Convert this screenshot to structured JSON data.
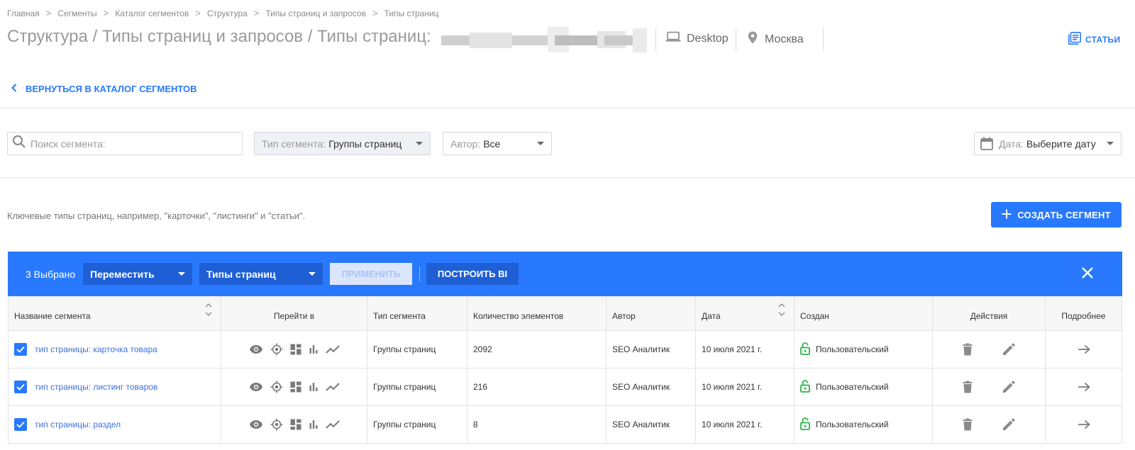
{
  "breadcrumb": [
    "Главная",
    "Сегменты",
    "Каталог сегментов",
    "Структура",
    "Типы страниц и запросов",
    "Типы страниц"
  ],
  "title": "Структура / Типы страниц и запросов / Типы страниц:",
  "device": "Desktop",
  "city": "Москва",
  "articles_link": "СТАТЬИ",
  "back_link": "ВЕРНУТЬСЯ В КАТАЛОГ СЕГМЕНТОВ",
  "filters": {
    "search_placeholder": "Поиск сегмента:",
    "type_label": "Тип сегмента:",
    "type_value": "Группы страниц",
    "author_label": "Автор:",
    "author_value": "Все",
    "date_label": "Дата:",
    "date_value": "Выберите дату"
  },
  "description": "Ключевые типы страниц, например, \"карточки\", \"листинги\" и \"статьи\".",
  "create_button": "СОЗДАТЬ СЕГМЕНТ",
  "bulk_bar": {
    "selected_count": "3 Выбрано",
    "action_select": "Переместить",
    "target_select": "Типы страниц",
    "apply_button": "ПРИМЕНИТЬ",
    "build_bi_button": "ПОСТРОИТЬ BI"
  },
  "table": {
    "headers": {
      "name": "Название сегмента",
      "goto": "Перейти в",
      "type": "Тип сегмента",
      "count": "Количество элементов",
      "author": "Автор",
      "date": "Дата",
      "created": "Создан",
      "actions": "Действия",
      "details": "Подробнее"
    },
    "rows": [
      {
        "name": "тип страницы: карточка товара",
        "type": "Группы страниц",
        "count": "2092",
        "author": "SEO Аналитик",
        "date": "10 июля 2021 г.",
        "created": "Пользовательский"
      },
      {
        "name": "тип страницы: листинг товаров",
        "type": "Группы страниц",
        "count": "216",
        "author": "SEO Аналитик",
        "date": "10 июля 2021 г.",
        "created": "Пользовательский"
      },
      {
        "name": "тип страницы: раздел",
        "type": "Группы страниц",
        "count": "8",
        "author": "SEO Аналитик",
        "date": "10 июля 2021 г.",
        "created": "Пользовательский"
      }
    ]
  },
  "colors": {
    "accent": "#2979ff",
    "lock": "#2bb34a"
  },
  "icons": [
    "laptop-icon",
    "map-pin-icon",
    "articles-icon",
    "chevron-left-icon",
    "search-icon",
    "calendar-icon",
    "plus-icon",
    "close-icon",
    "eye-icon",
    "crosshair-icon",
    "dashboard-icon",
    "bar-chart-icon",
    "trend-icon",
    "lock-open-icon",
    "trash-icon",
    "pencil-icon",
    "arrow-right-icon"
  ]
}
